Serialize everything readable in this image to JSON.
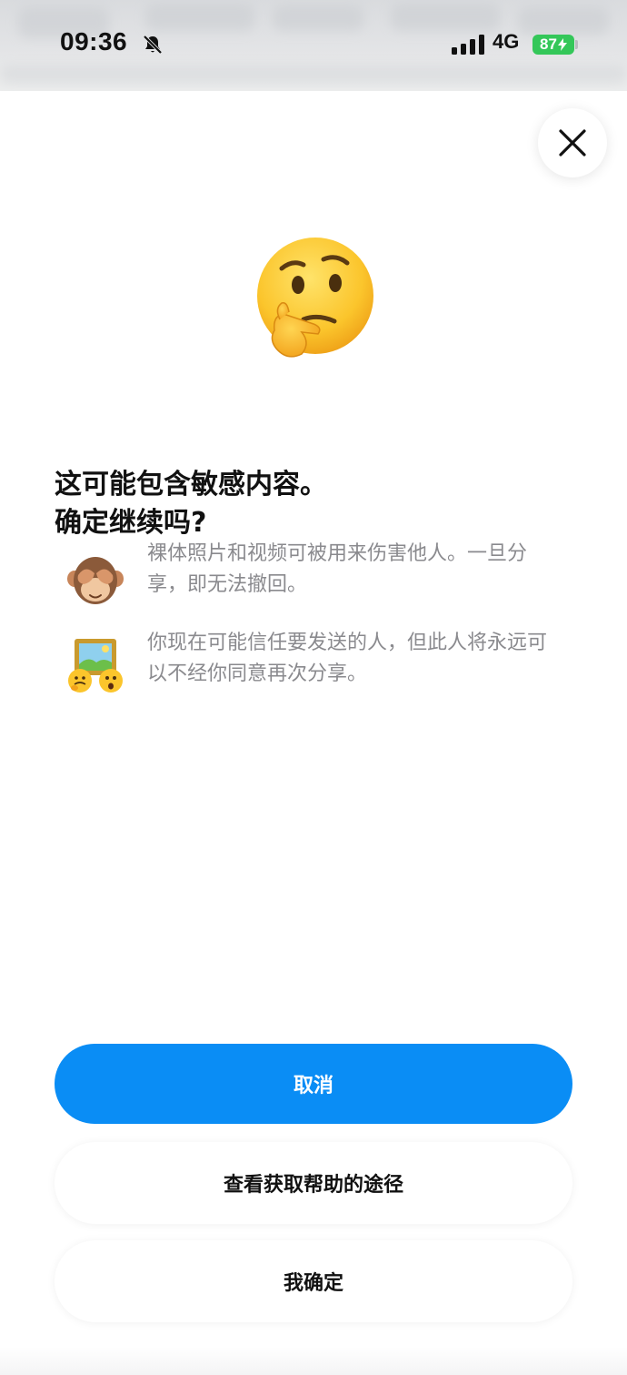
{
  "status_bar": {
    "time": "09:36",
    "network": "4G",
    "battery": "87",
    "icons": [
      "bell-off-icon",
      "signal-icon",
      "battery-icon"
    ]
  },
  "dialog": {
    "close_icon": "close-icon",
    "hero_icon": "thinking-face-icon",
    "title": "这可能包含敏感内容。\n确定继续吗?",
    "items": [
      {
        "icon": "see-no-evil-monkey-icon",
        "text": "裸体照片和视频可被用来伤害他人。一旦分享，即无法撤回。"
      },
      {
        "icon": "framed-picture-faces-icon",
        "text": "你现在可能信任要发送的人，但此人将永远可以不经你同意再次分享。"
      }
    ]
  },
  "buttons": {
    "cancel_label": "取消",
    "help_label": "查看获取帮助的途径",
    "confirm_label": "我确定"
  },
  "colors": {
    "primary": "#0a8df5",
    "battery": "#34c759",
    "secondary_text": "#8a8a8e"
  }
}
